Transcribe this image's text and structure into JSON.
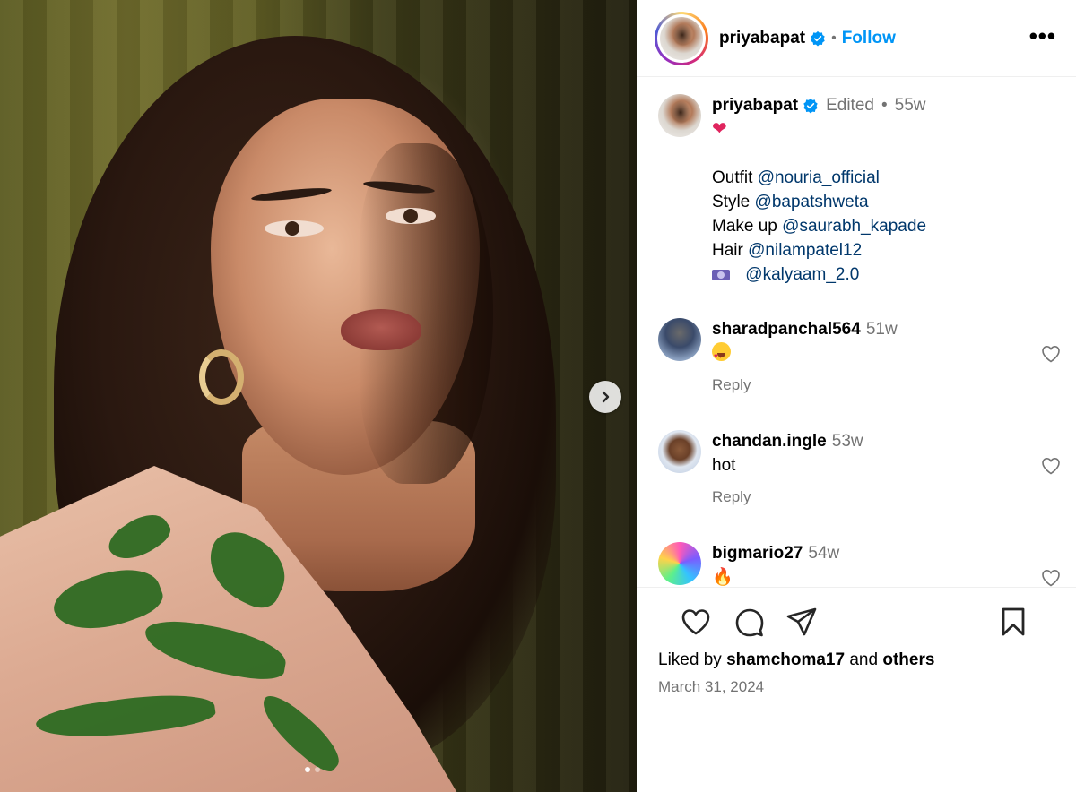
{
  "post": {
    "username": "priyabapat",
    "follow_label": "Follow",
    "separator": "•",
    "more_label": "•••"
  },
  "caption": {
    "username": "priyabapat",
    "edited_label": "Edited",
    "separator": "•",
    "time": "55w",
    "heart": "❤",
    "lines": [
      {
        "label": "Outfit",
        "tag": "@nouria_official"
      },
      {
        "label": "Style",
        "tag": "@bapatshweta"
      },
      {
        "label": "Make up",
        "tag": "@saurabh_kapade"
      },
      {
        "label": "Hair",
        "tag": "@nilampatel12"
      },
      {
        "label": "",
        "tag": "@kalyaam_2.0"
      }
    ]
  },
  "comments": [
    {
      "username": "sharadpanchal564",
      "time": "51w",
      "text": "",
      "reply": "Reply"
    },
    {
      "username": "chandan.ingle",
      "time": "53w",
      "text": "hot",
      "reply": "Reply"
    },
    {
      "username": "bigmario27",
      "time": "54w",
      "text": "🔥",
      "reply": ""
    }
  ],
  "likes": {
    "prefix": "Liked by",
    "user": "shamchoma17",
    "middle": "and",
    "others": "others"
  },
  "date": "March 31, 2024",
  "colors": {
    "link_blue": "#0095f6",
    "tag_blue": "#00376b",
    "muted": "#737373",
    "verified": "#0095f6"
  },
  "icons": [
    "more-options-icon",
    "verified-icon",
    "next-arrow-icon",
    "like-icon",
    "comment-icon",
    "share-icon",
    "save-icon"
  ]
}
